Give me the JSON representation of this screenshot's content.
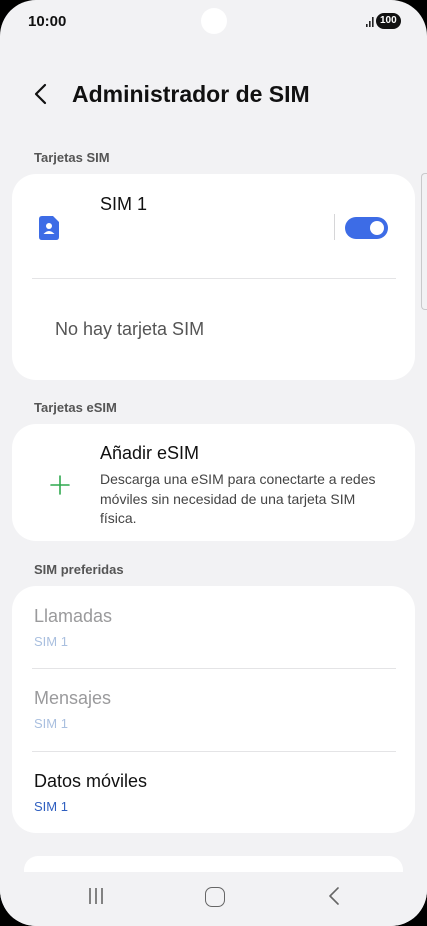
{
  "status_bar": {
    "time": "10:00",
    "battery": "100"
  },
  "header": {
    "title": "Administrador de SIM"
  },
  "sim_cards": {
    "section_label": "Tarjetas SIM",
    "sim1_label": "SIM 1",
    "sim1_enabled": true,
    "empty_slot_text": "No hay tarjeta SIM"
  },
  "esim": {
    "section_label": "Tarjetas eSIM",
    "add_title": "Añadir eSIM",
    "add_description": "Descarga una eSIM para conectarte a redes móviles sin necesidad de una tarjeta SIM física."
  },
  "preferred": {
    "section_label": "SIM preferidas",
    "items": [
      {
        "title": "Llamadas",
        "value": "SIM 1"
      },
      {
        "title": "Mensajes",
        "value": "SIM 1"
      },
      {
        "title": "Datos móviles",
        "value": "SIM 1"
      }
    ]
  },
  "colors": {
    "accent": "#3d6ce6",
    "background": "#f2f2f4",
    "card": "#ffffff",
    "plus": "#2fa84f"
  },
  "icons": [
    "back-arrow-icon",
    "sim-card-icon",
    "plus-icon",
    "recent-apps-icon",
    "home-icon",
    "nav-back-icon"
  ]
}
